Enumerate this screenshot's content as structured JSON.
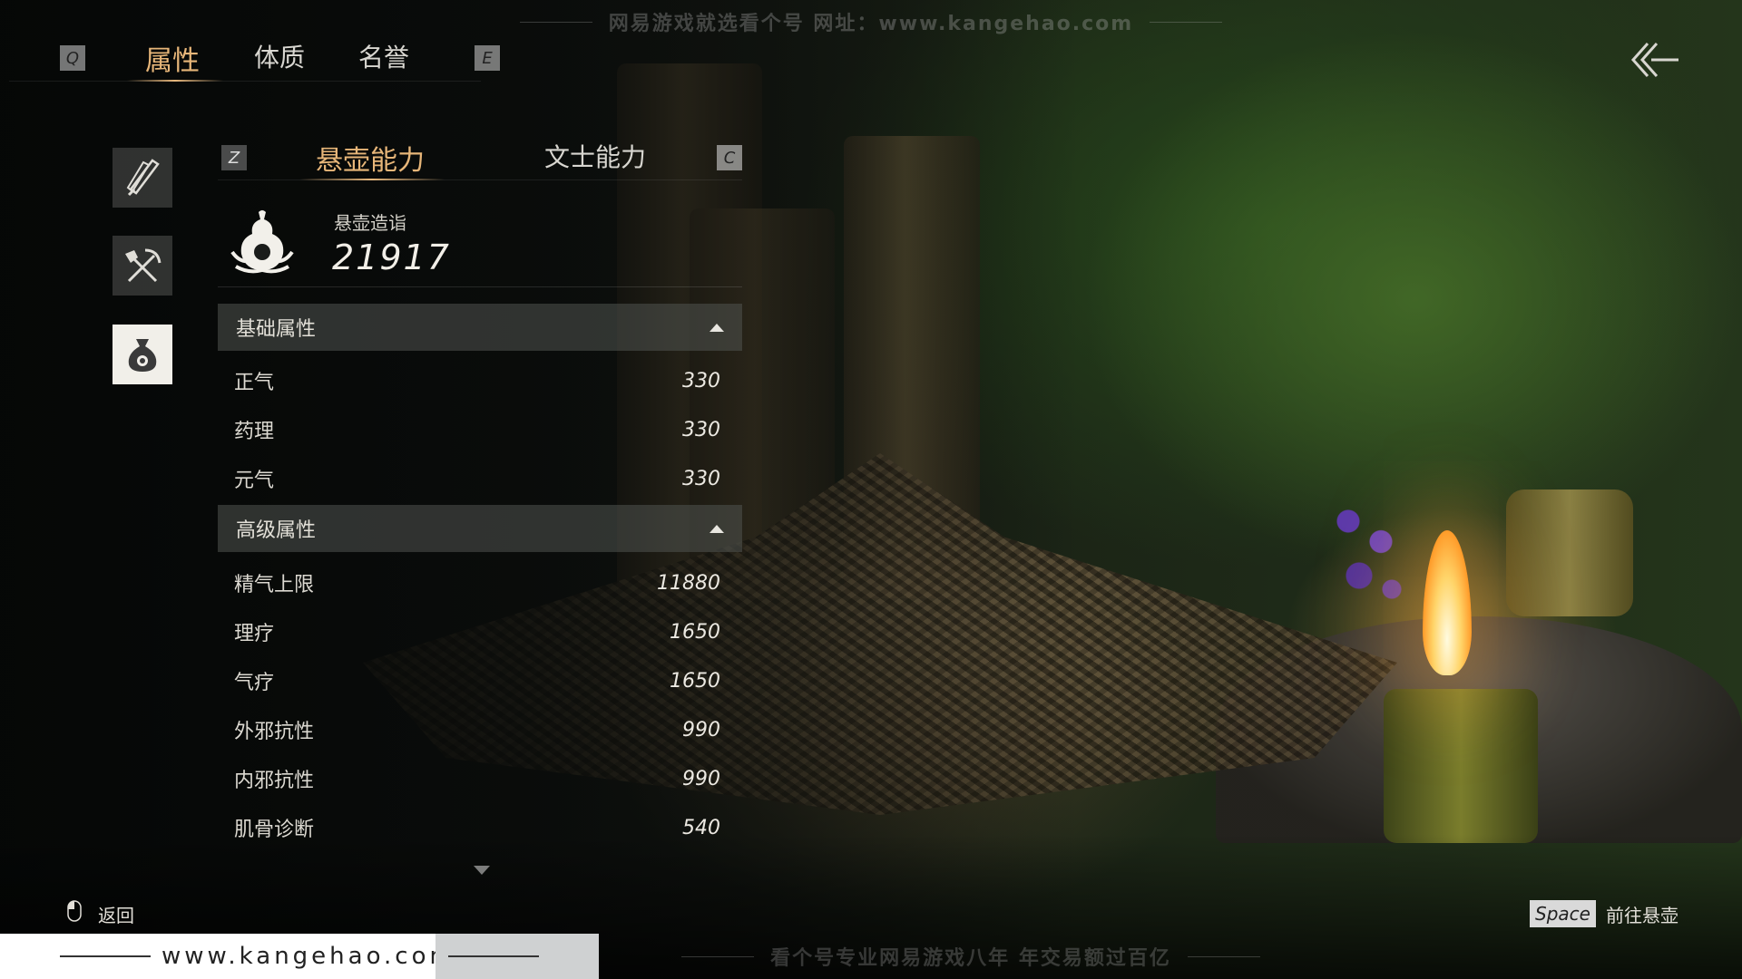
{
  "watermark": {
    "top": "网易游戏就选看个号  网址：www.kangehao.com",
    "bottom": "看个号专业网易游戏八年  年交易额过百亿"
  },
  "top_tabs": {
    "prev_key": "Q",
    "next_key": "E",
    "tabs": [
      {
        "label": "属性",
        "active": true
      },
      {
        "label": "体质",
        "active": false
      },
      {
        "label": "名誉",
        "active": false
      }
    ]
  },
  "sub_tabs": {
    "prev_key": "Z",
    "next_key": "C",
    "tabs": [
      {
        "label": "悬壶能力",
        "active": true
      },
      {
        "label": "文士能力",
        "active": false
      }
    ]
  },
  "side_icons": [
    "sword-icon",
    "pickaxe-shovel-icon",
    "medicine-bag-icon"
  ],
  "mastery": {
    "label": "悬壶造诣",
    "value": "21917",
    "icon": "gourd-icon"
  },
  "sections": [
    {
      "title": "基础属性",
      "expanded": true,
      "rows": [
        {
          "name": "正气",
          "value": "330"
        },
        {
          "name": "药理",
          "value": "330"
        },
        {
          "name": "元气",
          "value": "330"
        }
      ]
    },
    {
      "title": "高级属性",
      "expanded": true,
      "rows": [
        {
          "name": "精气上限",
          "value": "11880"
        },
        {
          "name": "理疗",
          "value": "1650"
        },
        {
          "name": "气疗",
          "value": "1650"
        },
        {
          "name": "外邪抗性",
          "value": "990"
        },
        {
          "name": "内邪抗性",
          "value": "990"
        },
        {
          "name": "肌骨诊断",
          "value": "540"
        }
      ]
    }
  ],
  "footer": {
    "back_label": "返回",
    "space_key": "Space",
    "goto_label": "前往悬壶"
  },
  "site_banner": {
    "text": "www.kangehao.com"
  },
  "colors": {
    "accent": "#e7b679",
    "text": "#e6e2d8",
    "section_bg": "#505450"
  }
}
